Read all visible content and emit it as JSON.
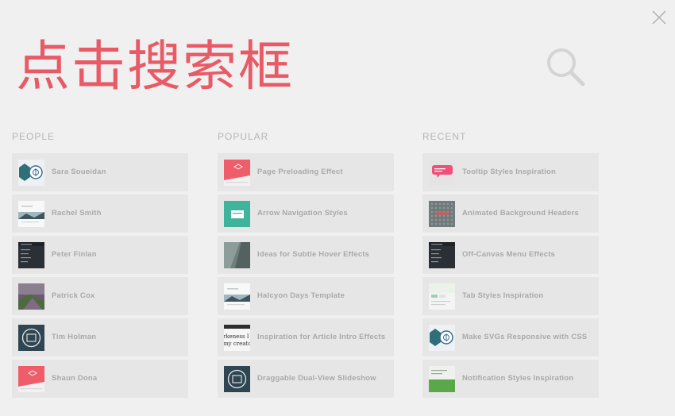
{
  "search": {
    "query": "点击搜索框"
  },
  "columns": [
    {
      "title": "PEOPLE",
      "items": [
        {
          "label": "Sara Soueidan",
          "thumb": "badge-teal"
        },
        {
          "label": "Rachel Smith",
          "thumb": "light-landscape"
        },
        {
          "label": "Peter Finlan",
          "thumb": "dark-menu"
        },
        {
          "label": "Patrick Cox",
          "thumb": "purple-photo"
        },
        {
          "label": "Tim Holman",
          "thumb": "circle-dark"
        },
        {
          "label": "Shaun Dona",
          "thumb": "pink-cube"
        }
      ]
    },
    {
      "title": "POPULAR",
      "items": [
        {
          "label": "Page Preloading Effect",
          "thumb": "pink-cube"
        },
        {
          "label": "Arrow Navigation Styles",
          "thumb": "teal-box"
        },
        {
          "label": "Ideas for Subtle Hover Effects",
          "thumb": "gray-photo"
        },
        {
          "label": "Halcyon Days Template",
          "thumb": "light-landscape"
        },
        {
          "label": "Inspiration for Article Intro Effects",
          "thumb": "text-snippet"
        },
        {
          "label": "Draggable Dual-View Slideshow",
          "thumb": "circle-dark"
        }
      ]
    },
    {
      "title": "RECENT",
      "items": [
        {
          "label": "Tooltip Styles Inspiration",
          "thumb": "pink-bubble"
        },
        {
          "label": "Animated Background Headers",
          "thumb": "dotted-gray"
        },
        {
          "label": "Off-Canvas Menu Effects",
          "thumb": "dark-menu"
        },
        {
          "label": "Tab Styles Inspiration",
          "thumb": "light-tabs"
        },
        {
          "label": "Make SVGs Responsive with CSS",
          "thumb": "badge-teal"
        },
        {
          "label": "Notification Styles Inspiration",
          "thumb": "green-bar"
        }
      ]
    }
  ],
  "thumb_snippet": {
    "line1": "rkeness I will",
    "line2": "my creators"
  },
  "colors": {
    "query": "#e85a66",
    "background": "#f0f0f0",
    "item": "#e6e6e6",
    "label": "#a9a9a9",
    "title": "#b6b6b6"
  }
}
